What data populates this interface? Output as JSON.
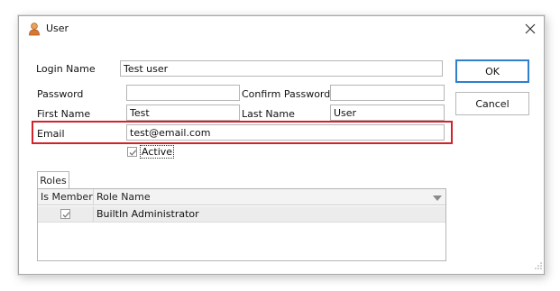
{
  "window": {
    "title": "User",
    "icon": "user-icon",
    "close_icon": "close-icon"
  },
  "form": {
    "login_name": {
      "label": "Login Name",
      "value": "Test user"
    },
    "password": {
      "label": "Password",
      "value": ""
    },
    "confirm_password": {
      "label": "Confirm Password",
      "value": ""
    },
    "first_name": {
      "label": "First Name",
      "value": "Test"
    },
    "last_name": {
      "label": "Last Name",
      "value": "User"
    },
    "email": {
      "label": "Email",
      "value": "test@email.com"
    },
    "active": {
      "label": "Active",
      "checked": true
    }
  },
  "buttons": {
    "ok": "OK",
    "cancel": "Cancel"
  },
  "roles": {
    "tab_label": "Roles",
    "columns": [
      "Is Member",
      "Role Name"
    ],
    "rows": [
      {
        "is_member": true,
        "role_name": "BuiltIn Administrator"
      }
    ]
  },
  "colors": {
    "highlight": "#d3222a",
    "primary_border": "#2f7fd0"
  }
}
